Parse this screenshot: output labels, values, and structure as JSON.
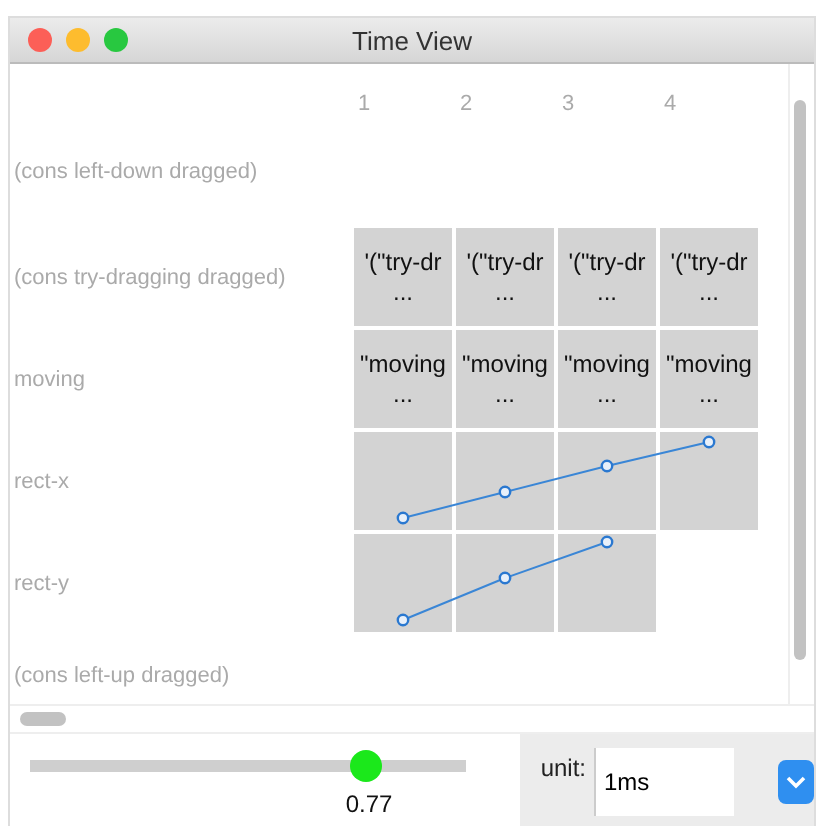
{
  "window": {
    "title": "Time View"
  },
  "columns": [
    "1",
    "2",
    "3",
    "4"
  ],
  "rows": [
    {
      "label": "(cons left-down dragged)",
      "kind": "empty"
    },
    {
      "label": "(cons try-dragging dragged)",
      "kind": "text",
      "cells": [
        {
          "kind": "text",
          "text": "'(\"try-dr",
          "more": "..."
        },
        {
          "kind": "text",
          "text": "'(\"try-dr",
          "more": "..."
        },
        {
          "kind": "text",
          "text": "'(\"try-dr",
          "more": "..."
        },
        {
          "kind": "text",
          "text": "'(\"try-dr",
          "more": "..."
        }
      ]
    },
    {
      "label": "moving",
      "kind": "text",
      "cells": [
        {
          "kind": "text",
          "text": "\"moving",
          "more": "..."
        },
        {
          "kind": "text",
          "text": "\"moving",
          "more": "..."
        },
        {
          "kind": "text",
          "text": "\"moving",
          "more": "..."
        },
        {
          "kind": "text",
          "text": "\"moving",
          "more": "..."
        }
      ]
    },
    {
      "label": "rect-x",
      "kind": "plot",
      "cells": [
        {
          "kind": "point"
        },
        {
          "kind": "point"
        },
        {
          "kind": "point"
        },
        {
          "kind": "point"
        }
      ]
    },
    {
      "label": "rect-y",
      "kind": "plot",
      "cells": [
        {
          "kind": "point"
        },
        {
          "kind": "point"
        },
        {
          "kind": "point"
        }
      ]
    },
    {
      "label": "(cons left-up dragged)",
      "kind": "empty"
    }
  ],
  "slider": {
    "level": 0.77,
    "reading": "0.77"
  },
  "unit": {
    "label": "unit:",
    "value": "1ms"
  }
}
